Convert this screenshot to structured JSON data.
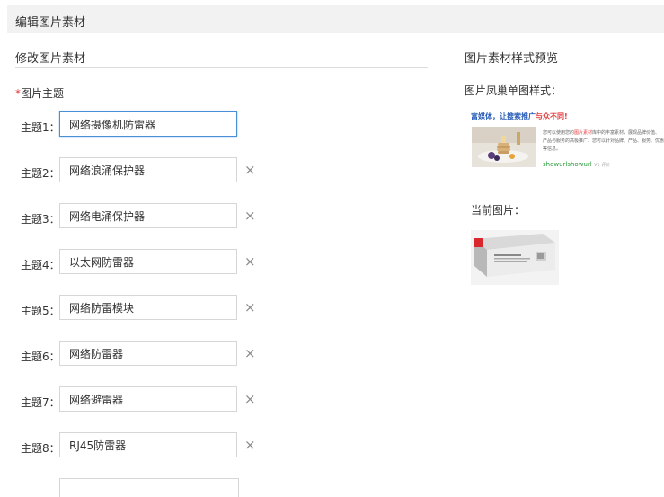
{
  "header": {
    "title": "编辑图片素材"
  },
  "form": {
    "section_title": "修改图片素材",
    "field_label": "图片主题",
    "required_mark": "*",
    "themes": [
      {
        "label": "主题1：",
        "value": "网络摄像机防雷器"
      },
      {
        "label": "主题2：",
        "value": "网络浪涌保护器"
      },
      {
        "label": "主题3：",
        "value": "网络电涌保护器"
      },
      {
        "label": "主题4：",
        "value": "以太网防雷器"
      },
      {
        "label": "主题5：",
        "value": "网络防雷模块"
      },
      {
        "label": "主题6：",
        "value": "网络防雷器"
      },
      {
        "label": "主题7：",
        "value": "网络避雷器"
      },
      {
        "label": "主题8：",
        "value": "RJ45防雷器"
      }
    ],
    "delete_icon": "×"
  },
  "preview": {
    "title": "图片素材样式预览",
    "style_label": "图片凤巢单图样式：",
    "sample_headline": "富媒体，让搜索推广",
    "sample_headline_red": "与众不同!",
    "sample_desc_1": "您可以使用您的",
    "sample_desc_red": "图片素材",
    "sample_desc_2": "库中的丰富素材，展现品牌价值、产品与服务的高极推广、您可以针对品牌、产品、服务、优惠等信息。",
    "sample_url": "showurlshowurl",
    "sample_url_small": "V1  评价",
    "current_label": "当前图片："
  },
  "colors": {
    "accent": "#4a90d9",
    "required": "#e4393c",
    "topbar": "#f2f2f2"
  }
}
